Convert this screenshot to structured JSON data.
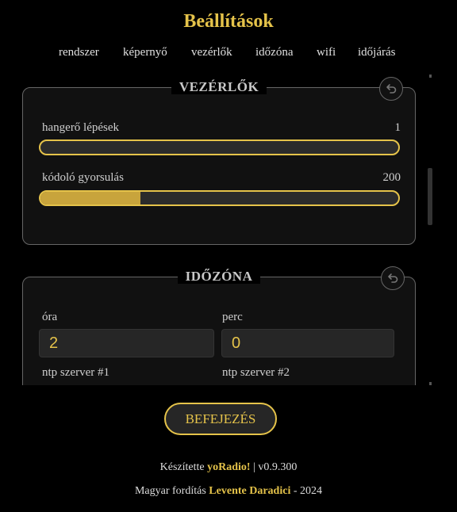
{
  "page": {
    "title": "Beállítások"
  },
  "nav": {
    "items": [
      {
        "label": "rendszer"
      },
      {
        "label": "képernyő"
      },
      {
        "label": "vezérlők"
      },
      {
        "label": "időzóna"
      },
      {
        "label": "wifi"
      },
      {
        "label": "időjárás"
      }
    ]
  },
  "controls": {
    "title": "VEZÉRLŐK",
    "volume_steps": {
      "label": "hangerő lépések",
      "value": "1",
      "fraction": 0.0
    },
    "encoder_accel": {
      "label": "kódoló gyorsulás",
      "value": "200",
      "fraction": 0.28
    }
  },
  "timezone": {
    "title": "IDŐZÓNA",
    "hour": {
      "label": "óra",
      "value": "2"
    },
    "minute": {
      "label": "perc",
      "value": "0"
    },
    "ntp1": {
      "label": "ntp szerver #1"
    },
    "ntp2": {
      "label": "ntp szerver #2"
    }
  },
  "actions": {
    "done_label": "BEFEJEZÉS"
  },
  "footer": {
    "made_by": "Készítette",
    "brand": "yoRadio!",
    "version": "| v0.9.300",
    "translation": "Magyar fordítás",
    "translator": "Levente Daradici",
    "year": "- 2024"
  },
  "colors": {
    "accent": "#e5c34a",
    "background": "#000000",
    "panel": "#111111"
  },
  "icons": {
    "reset": "undo-icon"
  }
}
